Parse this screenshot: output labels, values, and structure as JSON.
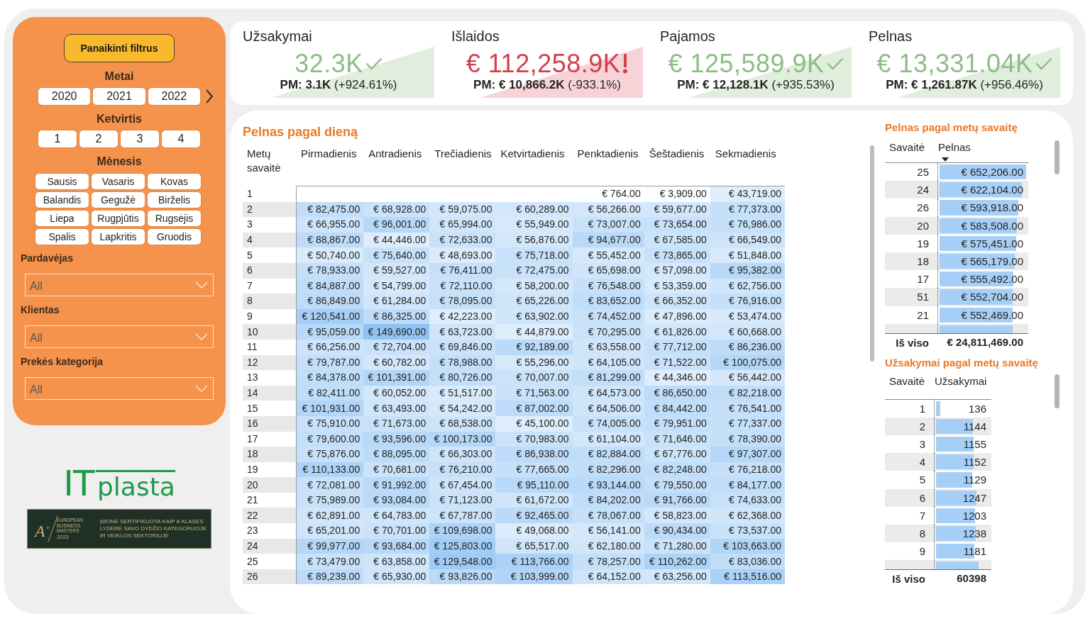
{
  "filters": {
    "clear_button": "Panaikinti filtrus",
    "slicers": [
      {
        "title": "Metai",
        "kind": "row",
        "scrollable": true,
        "options": [
          {
            "label": "2020",
            "selected": false
          },
          {
            "label": "2021",
            "selected": false
          },
          {
            "label": "2022",
            "selected": false
          }
        ]
      },
      {
        "title": "Ketvirtis",
        "kind": "row",
        "scrollable": false,
        "options": [
          {
            "label": "1",
            "selected": false
          },
          {
            "label": "2",
            "selected": false
          },
          {
            "label": "3",
            "selected": false
          },
          {
            "label": "4",
            "selected": false
          }
        ]
      },
      {
        "title": "Mėnesis",
        "kind": "grid",
        "scrollable": false,
        "options": [
          {
            "label": "Sausis",
            "selected": false
          },
          {
            "label": "Vasaris",
            "selected": false
          },
          {
            "label": "Kovas",
            "selected": false
          },
          {
            "label": "Balandis",
            "selected": false
          },
          {
            "label": "Gegužė",
            "selected": false
          },
          {
            "label": "Birželis",
            "selected": false
          },
          {
            "label": "Liepa",
            "selected": false
          },
          {
            "label": "Rugpjūtis",
            "selected": false
          },
          {
            "label": "Rugsėjis",
            "selected": false
          },
          {
            "label": "Spalis",
            "selected": false
          },
          {
            "label": "Lapkritis",
            "selected": false
          },
          {
            "label": "Gruodis",
            "selected": false
          }
        ]
      }
    ],
    "dropdowns": [
      {
        "label": "Pardavėjas",
        "value": "All"
      },
      {
        "label": "Klientas",
        "value": "All"
      },
      {
        "label": "Prekės kategorija",
        "value": "All"
      }
    ]
  },
  "logo": {
    "mark": "IT",
    "name": "plasta"
  },
  "award": {
    "mark": "A$^{+}$",
    "caption": [
      "EUROPEAN",
      "BUSINESS",
      "MASTERS",
      "2023"
    ],
    "lines": [
      "ĮMONĖ SERTIFIKUOTA KAIP A KLASĖS",
      "LYDERĖ SAVO DYDŽIO KATEGORIJOJE",
      "IR VEIKLOS SEKTORIUJE"
    ]
  },
  "kpis": [
    {
      "title": "Užsakymai",
      "value": "32.3K",
      "kind": "good",
      "comparison": "**PM: 3.1K** (+924.61%)"
    },
    {
      "title": "Išlaidos",
      "value": "€ 112,258.9K",
      "kind": "bad",
      "comparison": "**PM: € 10,866.2K** (-933.1%)"
    },
    {
      "title": "Pajamos",
      "value": "€ 125,589.9K",
      "kind": "good",
      "comparison": "**PM: € 12,128.1K** (+935.53%)"
    },
    {
      "title": "Pelnas",
      "value": "€ 13,331.04K",
      "kind": "good",
      "comparison": "**PM: € 1,261.87K** (+956.46%)"
    }
  ],
  "day_table": {
    "title": "Pelnas pagal dieną",
    "columns": [
      "Metų savaitė",
      "Pirmadienis",
      "Antradienis",
      "Trečiadienis",
      "Ketvirtadienis",
      "Penktadienis",
      "Šeštadienis",
      "Sekmadienis"
    ],
    "rows": [
      [
        "1",
        "",
        "",
        "",
        "",
        "€ 764.00",
        "€ 3,909.00",
        "€ 43,719.00"
      ],
      [
        "2",
        "€ 82,475.00",
        "€ 68,928.00",
        "€ 59,075.00",
        "€ 60,289.00",
        "€ 56,266.00",
        "€ 59,677.00",
        "€ 77,373.00"
      ],
      [
        "3",
        "€ 66,955.00",
        "€ 96,001.00",
        "€ 65,994.00",
        "€ 55,949.00",
        "€ 73,007.00",
        "€ 73,654.00",
        "€ 76,986.00"
      ],
      [
        "4",
        "€ 88,867.00",
        "€ 44,446.00",
        "€ 72,633.00",
        "€ 56,876.00",
        "€ 94,677.00",
        "€ 67,585.00",
        "€ 66,549.00"
      ],
      [
        "5",
        "€ 50,740.00",
        "€ 75,640.00",
        "€ 48,693.00",
        "€ 75,718.00",
        "€ 55,452.00",
        "€ 73,865.00",
        "€ 51,848.00"
      ],
      [
        "6",
        "€ 78,933.00",
        "€ 59,527.00",
        "€ 76,411.00",
        "€ 72,475.00",
        "€ 65,698.00",
        "€ 57,098.00",
        "€ 95,382.00"
      ],
      [
        "7",
        "€ 84,887.00",
        "€ 54,799.00",
        "€ 72,110.00",
        "€ 58,200.00",
        "€ 76,548.00",
        "€ 53,359.00",
        "€ 62,756.00"
      ],
      [
        "8",
        "€ 86,849.00",
        "€ 61,284.00",
        "€ 78,095.00",
        "€ 65,226.00",
        "€ 83,652.00",
        "€ 66,352.00",
        "€ 76,916.00"
      ],
      [
        "9",
        "€ 120,541.00",
        "€ 86,325.00",
        "€ 42,223.00",
        "€ 63,902.00",
        "€ 74,452.00",
        "€ 47,896.00",
        "€ 53,474.00"
      ],
      [
        "10",
        "€ 95,059.00",
        "€ 149,690.00",
        "€ 63,723.00",
        "€ 44,879.00",
        "€ 70,295.00",
        "€ 61,826.00",
        "€ 60,668.00"
      ],
      [
        "11",
        "€ 66,256.00",
        "€ 72,704.00",
        "€ 69,846.00",
        "€ 92,189.00",
        "€ 63,558.00",
        "€ 77,712.00",
        "€ 86,236.00"
      ],
      [
        "12",
        "€ 79,787.00",
        "€ 60,782.00",
        "€ 78,988.00",
        "€ 55,296.00",
        "€ 64,105.00",
        "€ 71,522.00",
        "€ 100,075.00"
      ],
      [
        "13",
        "€ 84,378.00",
        "€ 101,391.00",
        "€ 80,726.00",
        "€ 70,007.00",
        "€ 81,299.00",
        "€ 44,346.00",
        "€ 56,442.00"
      ],
      [
        "14",
        "€ 82,411.00",
        "€ 60,052.00",
        "€ 51,517.00",
        "€ 71,563.00",
        "€ 64,573.00",
        "€ 86,650.00",
        "€ 82,218.00"
      ],
      [
        "15",
        "€ 101,931.00",
        "€ 63,493.00",
        "€ 54,242.00",
        "€ 87,002.00",
        "€ 64,506.00",
        "€ 84,442.00",
        "€ 76,541.00"
      ],
      [
        "16",
        "€ 75,910.00",
        "€ 71,673.00",
        "€ 68,538.00",
        "€ 45,100.00",
        "€ 74,005.00",
        "€ 79,951.00",
        "€ 77,337.00"
      ],
      [
        "17",
        "€ 79,600.00",
        "€ 93,596.00",
        "€ 100,173.00",
        "€ 70,983.00",
        "€ 61,104.00",
        "€ 71,646.00",
        "€ 78,390.00"
      ],
      [
        "18",
        "€ 75,876.00",
        "€ 88,095.00",
        "€ 66,303.00",
        "€ 86,938.00",
        "€ 82,884.00",
        "€ 67,776.00",
        "€ 97,307.00"
      ],
      [
        "19",
        "€ 110,133.00",
        "€ 70,681.00",
        "€ 76,210.00",
        "€ 77,665.00",
        "€ 82,296.00",
        "€ 82,248.00",
        "€ 76,218.00"
      ],
      [
        "20",
        "€ 72,081.00",
        "€ 91,992.00",
        "€ 67,454.00",
        "€ 95,110.00",
        "€ 93,144.00",
        "€ 79,550.00",
        "€ 84,177.00"
      ],
      [
        "21",
        "€ 75,989.00",
        "€ 93,084.00",
        "€ 71,123.00",
        "€ 61,672.00",
        "€ 84,202.00",
        "€ 91,766.00",
        "€ 74,633.00"
      ],
      [
        "22",
        "€ 62,891.00",
        "€ 64,783.00",
        "€ 67,787.00",
        "€ 92,465.00",
        "€ 78,067.00",
        "€ 58,823.00",
        "€ 62,368.00"
      ],
      [
        "23",
        "€ 65,201.00",
        "€ 70,701.00",
        "€ 109,698.00",
        "€ 49,068.00",
        "€ 56,141.00",
        "€ 90,434.00",
        "€ 73,537.00"
      ],
      [
        "24",
        "€ 99,977.00",
        "€ 93,684.00",
        "€ 125,803.00",
        "€ 65,517.00",
        "€ 62,180.00",
        "€ 71,280.00",
        "€ 103,663.00"
      ],
      [
        "25",
        "€ 73,479.00",
        "€ 63,858.00",
        "€ 129,548.00",
        "€ 113,766.00",
        "€ 78,257.00",
        "€ 110,262.00",
        "€ 83,036.00"
      ],
      [
        "26",
        "€ 89,239.00",
        "€ 65,930.00",
        "€ 93,826.00",
        "€ 103,999.00",
        "€ 64,152.00",
        "€ 63,256.00",
        "€ 113,516.00"
      ]
    ]
  },
  "week_profit_table": {
    "title": "Pelnas pagal metų savaitę",
    "columns": [
      {
        "label": "Savaitė",
        "sorted": false
      },
      {
        "label": "Pelnas",
        "sorted": true
      }
    ],
    "rows": [
      {
        "week": "25",
        "value": "€ 652,206.00",
        "level": 1.0
      },
      {
        "week": "24",
        "value": "€ 622,104.00",
        "level": 0.954
      },
      {
        "week": "26",
        "value": "€ 593,918.00",
        "level": 0.911
      },
      {
        "week": "20",
        "value": "€ 583,508.00",
        "level": 0.895
      },
      {
        "week": "19",
        "value": "€ 575,451.00",
        "level": 0.882
      },
      {
        "week": "18",
        "value": "€ 565,179.00",
        "level": 0.867
      },
      {
        "week": "17",
        "value": "€ 555,492.00",
        "level": 0.852
      },
      {
        "week": "51",
        "value": "€ 552,704.00",
        "level": 0.847
      },
      {
        "week": "21",
        "value": "€ 552,469.00",
        "level": 0.847
      },
      {
        "level": 0.846
      }
    ],
    "total": {
      "label": "Iš viso",
      "value": "€ 24,811,469.00"
    }
  },
  "week_orders_table": {
    "title": "Užsakymai pagal metų savaitę",
    "columns": [
      {
        "label": "Savaitė",
        "sorted": false
      },
      {
        "label": "Užsakymai",
        "sorted": false
      }
    ],
    "rows": [
      {
        "week": "1",
        "value": "136",
        "level": 0.08
      },
      {
        "week": "2",
        "value": "1144",
        "level": 0.69
      },
      {
        "week": "3",
        "value": "1155",
        "level": 0.7
      },
      {
        "week": "4",
        "value": "1152",
        "level": 0.7
      },
      {
        "week": "5",
        "value": "1129",
        "level": 0.68
      },
      {
        "week": "6",
        "value": "1247",
        "level": 0.755
      },
      {
        "week": "7",
        "value": "1203",
        "level": 0.73
      },
      {
        "week": "8",
        "value": "1238",
        "level": 0.75
      },
      {
        "week": "9",
        "value": "1181",
        "level": 0.715
      },
      {
        "level": 0.8
      }
    ],
    "total": {
      "label": "Iš viso",
      "value": "60398"
    }
  }
}
